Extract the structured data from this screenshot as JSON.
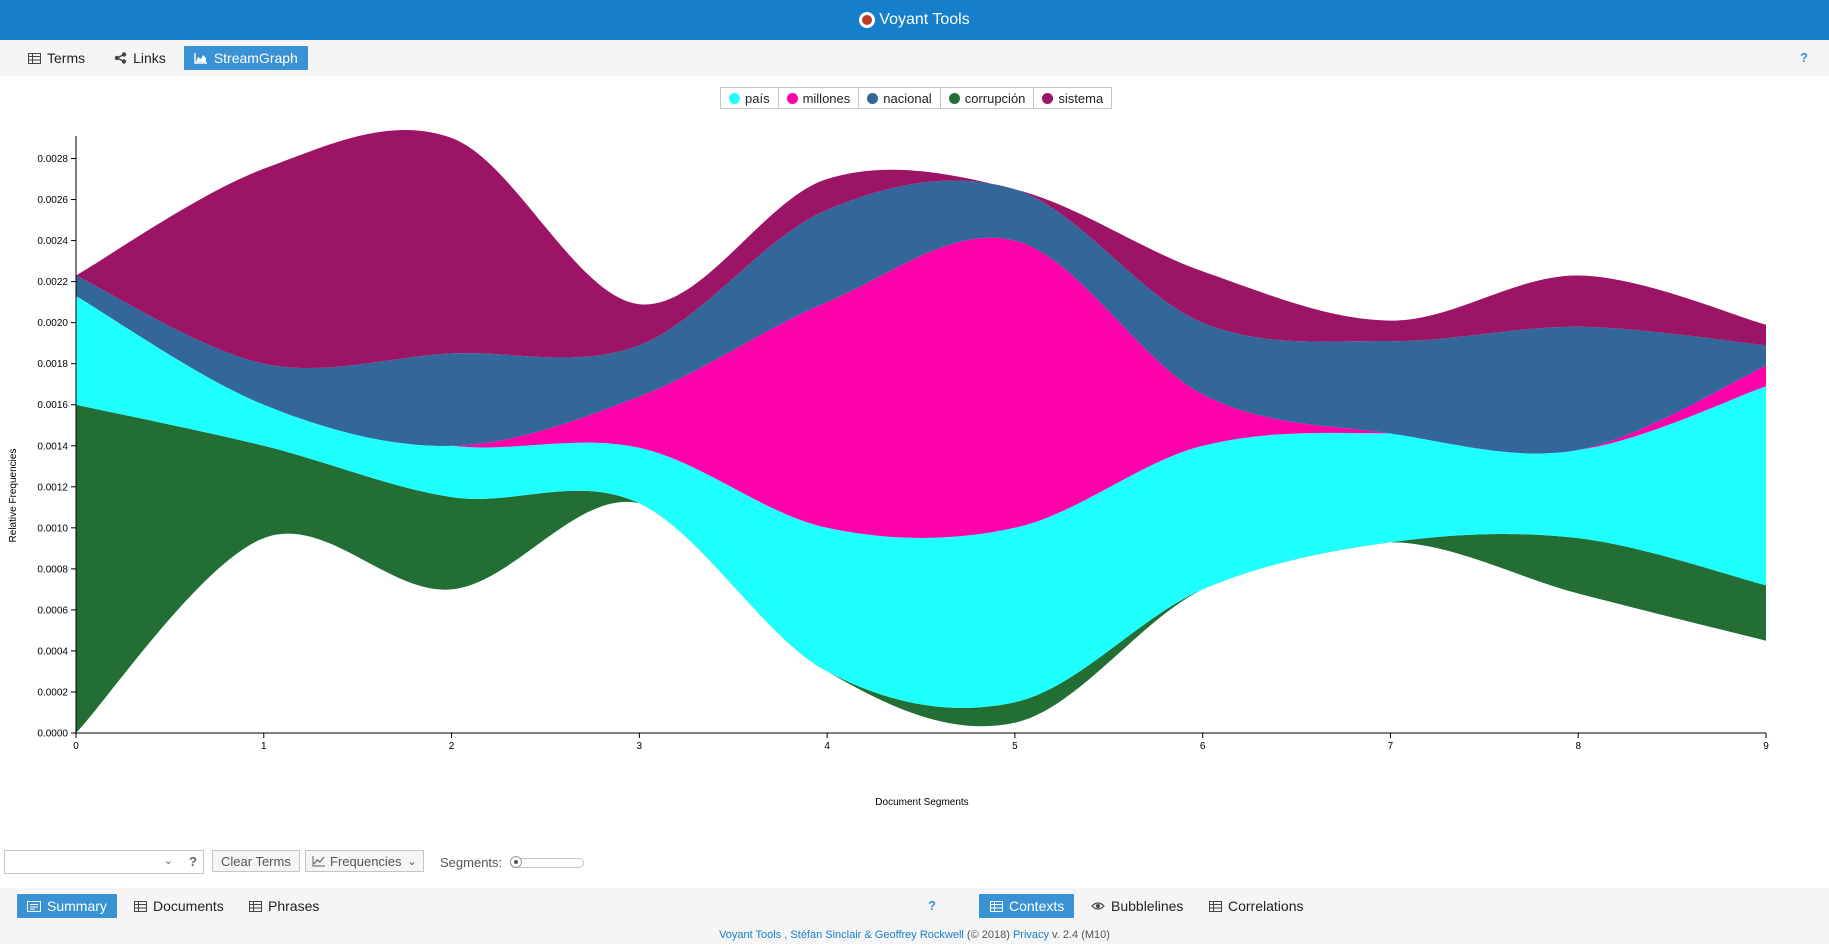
{
  "app": {
    "title": "Voyant Tools"
  },
  "top_tabs": [
    {
      "label": "Terms",
      "icon": "table-icon"
    },
    {
      "label": "Links",
      "icon": "share-icon"
    },
    {
      "label": "StreamGraph",
      "icon": "area-chart-icon",
      "active": true
    }
  ],
  "help_label": "?",
  "chart_data": {
    "type": "area",
    "subtype": "streamgraph",
    "xlabel": "Document Segments",
    "ylabel": "Relative Frequencies",
    "x": [
      0,
      1,
      2,
      3,
      4,
      5,
      6,
      7,
      8,
      9
    ],
    "ylim": [
      0,
      0.0029
    ],
    "yticks": [
      "0.0000",
      "0.0002",
      "0.0004",
      "0.0006",
      "0.0008",
      "0.0010",
      "0.0012",
      "0.0014",
      "0.0016",
      "0.0018",
      "0.0020",
      "0.0022",
      "0.0024",
      "0.0026",
      "0.0028"
    ],
    "baseline": [
      0.0,
      0.00095,
      0.0007,
      0.00112,
      0.0003,
      5e-05,
      0.0007,
      0.00093,
      0.00068,
      0.00045
    ],
    "series": [
      {
        "name": "corrupción",
        "color": "#226e35",
        "values": [
          0.0016,
          0.00045,
          0.00045,
          0.0,
          0.0,
          0.0001,
          0.0,
          0.0,
          0.00027,
          0.00027
        ]
      },
      {
        "name": "país",
        "color": "#1ffffd",
        "values": [
          0.00053,
          0.0002,
          0.00025,
          0.00027,
          0.0007,
          0.00085,
          0.0007,
          0.00053,
          0.00043,
          0.00097
        ]
      },
      {
        "name": "millones",
        "color": "#ff00aa",
        "values": [
          0.0,
          0.0,
          0.0,
          0.00025,
          0.0011,
          0.0014,
          0.00025,
          0.0,
          0.0,
          0.0001
        ]
      },
      {
        "name": "nacional",
        "color": "#336699",
        "values": [
          0.0001,
          0.0002,
          0.00045,
          0.00025,
          0.00045,
          0.00025,
          0.00035,
          0.00045,
          0.0006,
          0.0001
        ]
      },
      {
        "name": "sistema",
        "color": "#9b1466",
        "values": [
          0.0,
          0.00095,
          0.00105,
          0.0002,
          0.00015,
          0.0,
          0.00025,
          0.0001,
          0.00025,
          0.0001
        ]
      }
    ],
    "legend": [
      {
        "name": "país",
        "color": "#1ffffd"
      },
      {
        "name": "millones",
        "color": "#ff00aa"
      },
      {
        "name": "nacional",
        "color": "#336699"
      },
      {
        "name": "corrupción",
        "color": "#226e35"
      },
      {
        "name": "sistema",
        "color": "#9b1466"
      }
    ],
    "legend_placement": "top-center"
  },
  "toolbar": {
    "term_select_value": "",
    "clear_terms": "Clear Terms",
    "frequencies": "Frequencies",
    "segments_label": "Segments:",
    "segments_slider_value": 0
  },
  "bottom_left_tabs": [
    {
      "label": "Summary",
      "icon": "summary-icon",
      "active": true
    },
    {
      "label": "Documents",
      "icon": "table-icon"
    },
    {
      "label": "Phrases",
      "icon": "table-icon"
    }
  ],
  "bottom_right_tabs": [
    {
      "label": "Contexts",
      "icon": "table-icon",
      "active": true
    },
    {
      "label": "Bubblelines",
      "icon": "eye-icon"
    },
    {
      "label": "Correlations",
      "icon": "table-icon"
    }
  ],
  "footer": {
    "voyant": "Voyant Tools",
    "comma": " , ",
    "authors": "Stéfan Sinclair & Geoffrey Rockwell",
    "copyright": " (© 2018) ",
    "privacy": "Privacy",
    "version": " v. 2.4 (M10)"
  }
}
